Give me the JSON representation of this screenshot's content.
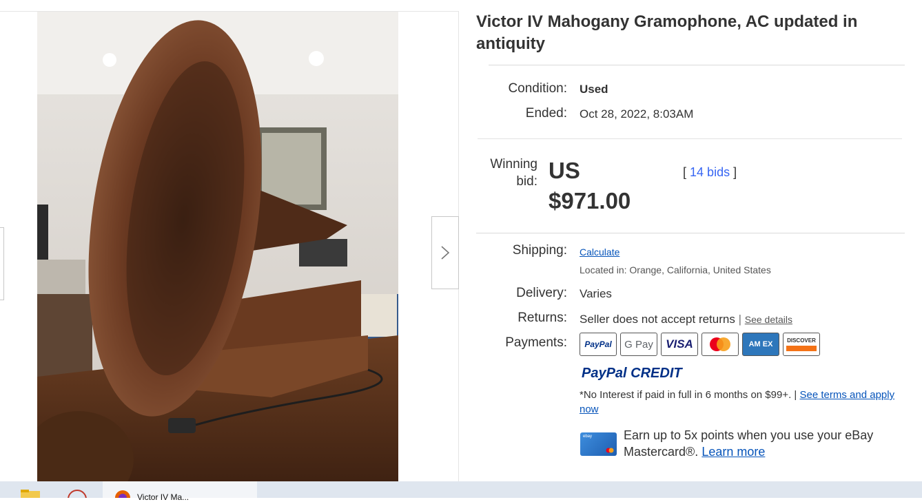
{
  "listing": {
    "title": "Victor IV Mahogany Gramophone, AC updated in antiquity",
    "condition_label": "Condition:",
    "condition_value": "Used",
    "ended_label": "Ended:",
    "ended_value": "Oct 28, 2022, 8:03AM",
    "winning_bid_label": "Winning bid:",
    "winning_bid_currency": "US",
    "winning_bid_amount": "$971.00",
    "bids_open": "[",
    "bids_link": "14 bids",
    "bids_close": "]"
  },
  "shipping": {
    "label": "Shipping:",
    "value": "Calculate",
    "location": "Located in: Orange, California, United States"
  },
  "delivery": {
    "label": "Delivery:",
    "value": "Varies"
  },
  "returns": {
    "label": "Returns:",
    "value": "Seller does not accept returns",
    "separator": "|",
    "link": "See details"
  },
  "payments": {
    "label": "Payments:",
    "methods": [
      "PayPal",
      "G Pay",
      "VISA",
      "Mastercard",
      "AM EX",
      "DISCOVER"
    ]
  },
  "paypal_credit": {
    "brand_a": "PayPal",
    "brand_b": "CREDIT",
    "terms": "*No Interest if paid in full in 6 months on $99+. |",
    "terms_link": "See terms and apply now"
  },
  "mastercard_promo": {
    "card_label": "ebay",
    "text": "Earn up to 5x points when you use your eBay Mastercard®.",
    "link": "Learn more"
  },
  "taskbar": {
    "active_title": "Victor IV Ma..."
  },
  "colors": {
    "link": "#0654ba",
    "bids_link": "#3665f3",
    "text": "#333333"
  }
}
